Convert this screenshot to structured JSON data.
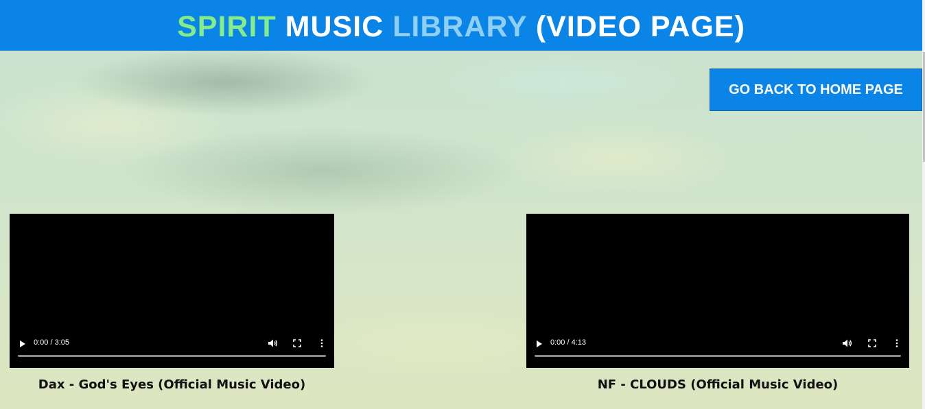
{
  "header": {
    "title_words": [
      "SPIRIT",
      "MUSIC",
      "LIBRARY",
      "(VIDEO PAGE)"
    ],
    "word_colors": [
      "#86ec8a",
      "#ffffff",
      "#8fd0f2",
      "#ffffff"
    ],
    "background_color": "#0a84e6"
  },
  "nav": {
    "home_button_label": "GO BACK TO HOME PAGE"
  },
  "videos": [
    {
      "time": "0:00 / 3:05",
      "caption": "Dax - God's Eyes (Official Music Video)",
      "progress": 0,
      "icons": [
        "play-icon",
        "volume-icon",
        "fullscreen-icon",
        "more-options-icon"
      ]
    },
    {
      "time": "0:00 / 4:13",
      "caption": "NF - CLOUDS (Official Music Video)",
      "progress": 0,
      "icons": [
        "play-icon",
        "volume-icon",
        "fullscreen-icon",
        "more-options-icon"
      ]
    }
  ]
}
